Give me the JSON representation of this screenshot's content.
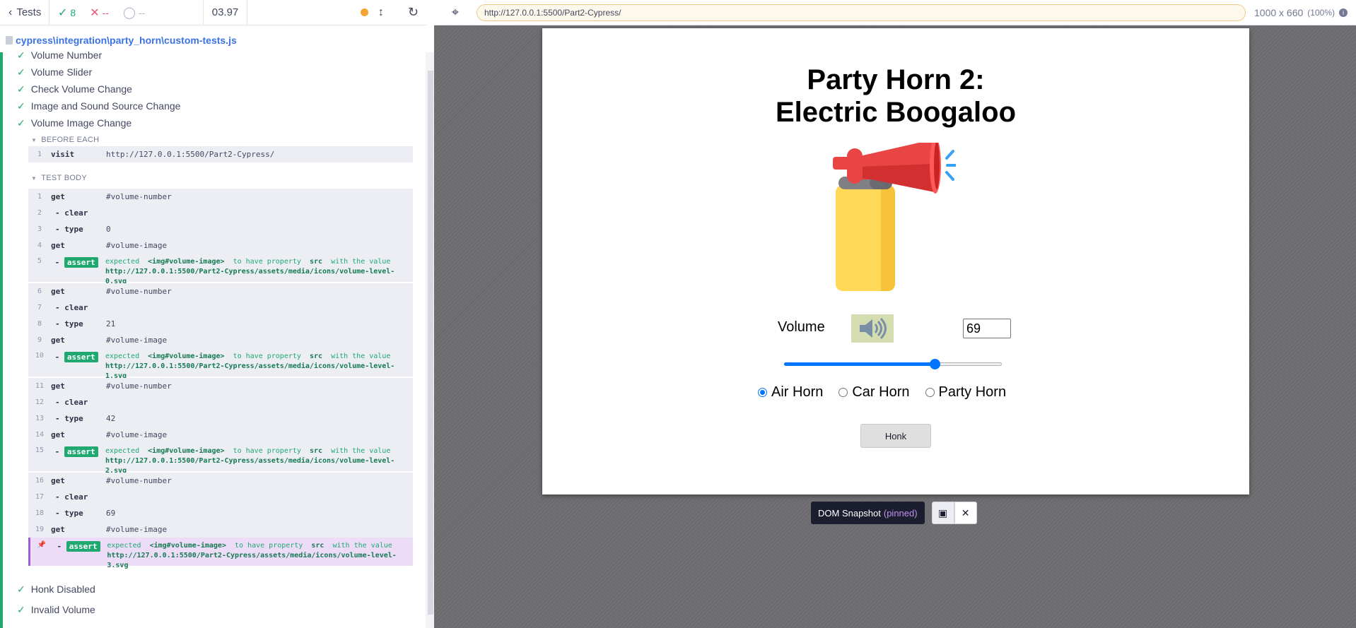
{
  "topbar": {
    "tests_label": "Tests",
    "passed": "8",
    "failed": "--",
    "pending": "--",
    "duration": "03.97"
  },
  "spec": {
    "path": "cypress\\integration\\party_horn\\custom-tests.js"
  },
  "tests": [
    "Volume Number",
    "Volume Slider",
    "Check Volume Change",
    "Image and Sound Source Change",
    "Volume Image Change",
    "Honk Disabled",
    "Invalid Volume"
  ],
  "hooks": {
    "before_each": "BEFORE EACH",
    "test_body": "TEST BODY"
  },
  "before_each_cmd": {
    "n": "1",
    "name": "visit",
    "msg": "http://127.0.0.1:5500/Part2-Cypress/"
  },
  "commands": [
    {
      "n": "1",
      "name": "get",
      "msg": "#volume-number"
    },
    {
      "n": "2",
      "name": "- clear",
      "msg": ""
    },
    {
      "n": "3",
      "name": "- type",
      "msg": "0"
    },
    {
      "n": "4",
      "name": "get",
      "msg": "#volume-image"
    },
    {
      "n": "5",
      "name": "- assert",
      "expected": "expected",
      "subject": "<img#volume-image>",
      "mid": "to have property",
      "prop": "src",
      "tail": "with the value",
      "url": "http://127.0.0.1:5500/Part2-Cypress/assets/media/icons/volume-level-0.svg"
    },
    {
      "n": "6",
      "name": "get",
      "msg": "#volume-number"
    },
    {
      "n": "7",
      "name": "- clear",
      "msg": ""
    },
    {
      "n": "8",
      "name": "- type",
      "msg": "21"
    },
    {
      "n": "9",
      "name": "get",
      "msg": "#volume-image"
    },
    {
      "n": "10",
      "name": "- assert",
      "expected": "expected",
      "subject": "<img#volume-image>",
      "mid": "to have property",
      "prop": "src",
      "tail": "with the value",
      "url": "http://127.0.0.1:5500/Part2-Cypress/assets/media/icons/volume-level-1.svg"
    },
    {
      "n": "11",
      "name": "get",
      "msg": "#volume-number"
    },
    {
      "n": "12",
      "name": "- clear",
      "msg": ""
    },
    {
      "n": "13",
      "name": "- type",
      "msg": "42"
    },
    {
      "n": "14",
      "name": "get",
      "msg": "#volume-image"
    },
    {
      "n": "15",
      "name": "- assert",
      "expected": "expected",
      "subject": "<img#volume-image>",
      "mid": "to have property",
      "prop": "src",
      "tail": "with the value",
      "url": "http://127.0.0.1:5500/Part2-Cypress/assets/media/icons/volume-level-2.svg"
    },
    {
      "n": "16",
      "name": "get",
      "msg": "#volume-number"
    },
    {
      "n": "17",
      "name": "- clear",
      "msg": ""
    },
    {
      "n": "18",
      "name": "- type",
      "msg": "69"
    },
    {
      "n": "19",
      "name": "get",
      "msg": "#volume-image"
    },
    {
      "n": "",
      "name": "- assert",
      "expected": "expected",
      "subject": "<img#volume-image>",
      "mid": "to have property",
      "prop": "src",
      "tail": "with the value",
      "url": "http://127.0.0.1:5500/Part2-Cypress/assets/media/icons/volume-level-3.svg"
    }
  ],
  "browser": {
    "url": "http://127.0.0.1:5500/Part2-Cypress/",
    "viewport": "1000 x 660",
    "zoom": "(100%)"
  },
  "app": {
    "title_line1": "Party Horn 2:",
    "title_line2": "Electric Boogaloo",
    "volume_label": "Volume",
    "volume_value": "69",
    "slider_level": 0.69,
    "radios": [
      "Air Horn",
      "Car Horn",
      "Party Horn"
    ],
    "radio_selected": 0,
    "honk_label": "Honk"
  },
  "snapshot": {
    "label": "DOM Snapshot",
    "pinned": "(pinned)"
  },
  "colors": {
    "pass": "#1fa971",
    "fail": "#e45770",
    "accent": "#0075ff",
    "pin": "#a05fd1"
  }
}
